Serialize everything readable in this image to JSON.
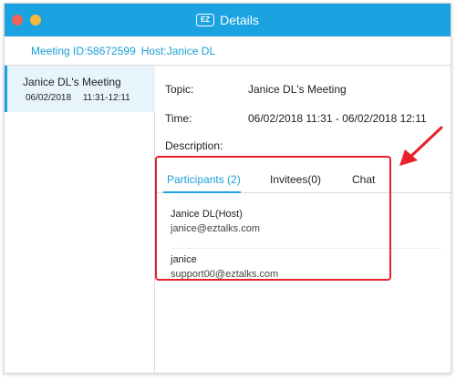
{
  "window": {
    "title": "Details",
    "app_icon_text": "EZ"
  },
  "meeting_bar": {
    "meeting_id": "Meeting ID:58672599",
    "host": "Host:Janice DL"
  },
  "sidebar": {
    "items": [
      {
        "name": "Janice DL's Meeting",
        "date": "06/02/2018",
        "time": "11:31-12:11"
      }
    ]
  },
  "details": {
    "topic_label": "Topic:",
    "topic_value": "Janice DL's Meeting",
    "time_label": "Time:",
    "time_value": "06/02/2018 11:31 - 06/02/2018 12:11",
    "description_label": "Description:"
  },
  "tabs": [
    {
      "label": "Participants (2)",
      "active": true
    },
    {
      "label": "Invitees(0)",
      "active": false
    },
    {
      "label": "Chat",
      "active": false
    }
  ],
  "participants": [
    {
      "name": "Janice DL(Host)",
      "email": "janice@eztalks.com"
    },
    {
      "name": "janice",
      "email": "support00@eztalks.com"
    }
  ],
  "colors": {
    "accent": "#1aa3e0",
    "highlight": "#e8202a"
  }
}
